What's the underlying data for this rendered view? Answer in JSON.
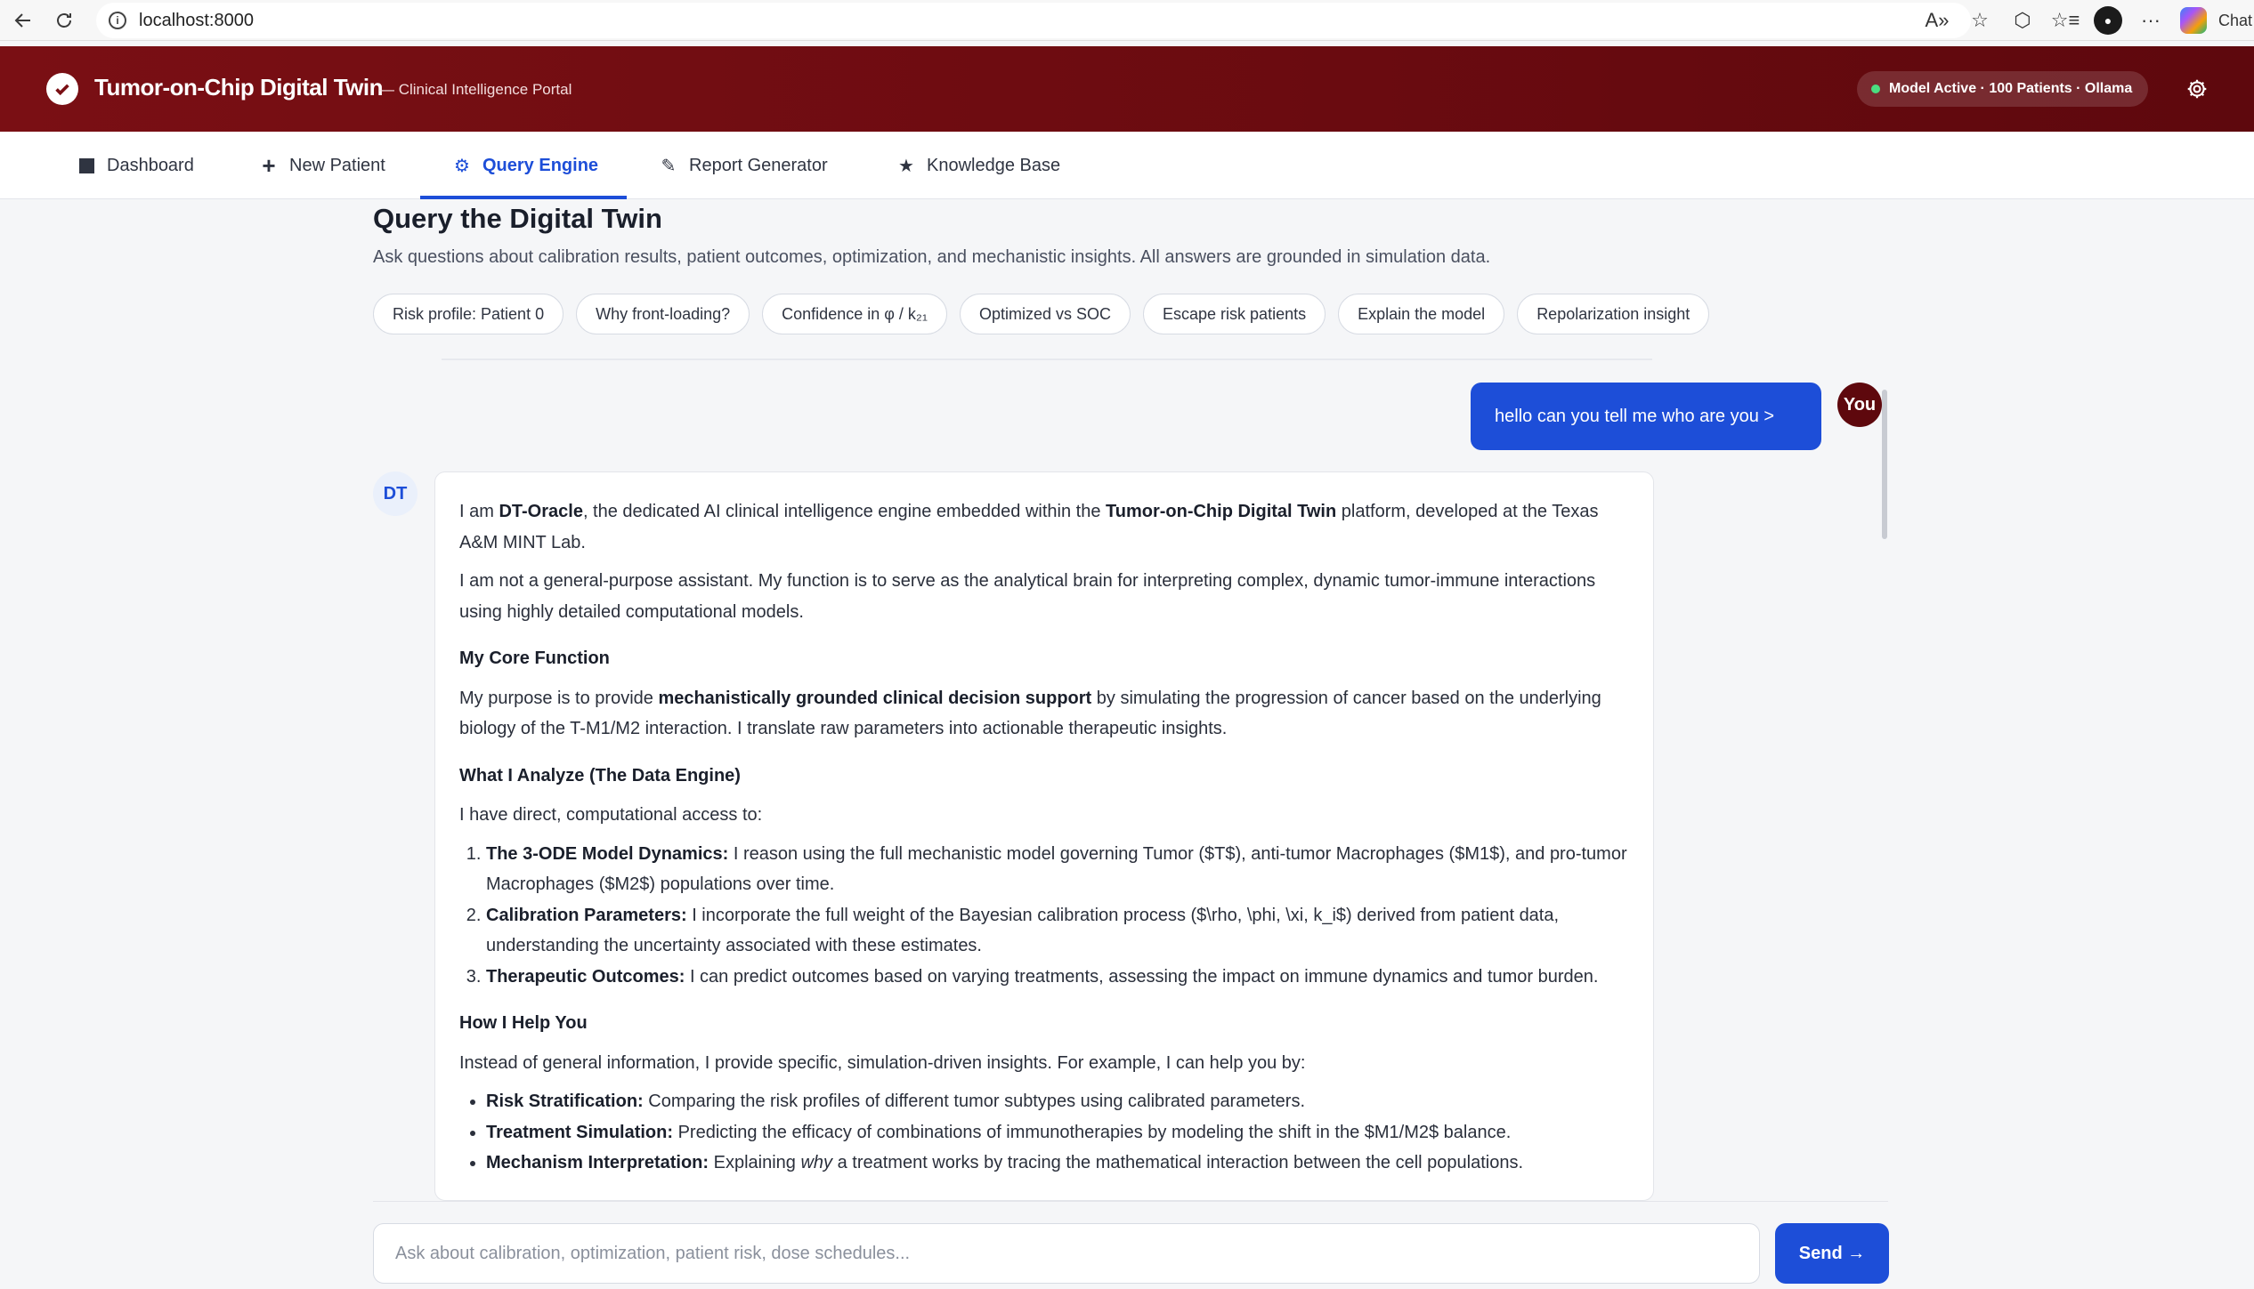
{
  "browser": {
    "url": "localhost:8000",
    "chat_label": "Chat"
  },
  "header": {
    "title": "Tumor-on-Chip Digital Twin",
    "subtitle": "— Clinical Intelligence Portal",
    "status": "Model Active · 100 Patients · Ollama",
    "accent": "#6a0b10"
  },
  "tabs": [
    {
      "label": "Dashboard",
      "icon": "square-icon"
    },
    {
      "label": "New Patient",
      "icon": "plus-icon"
    },
    {
      "label": "Query Engine",
      "icon": "gear-icon",
      "active": true
    },
    {
      "label": "Report Generator",
      "icon": "pen-icon"
    },
    {
      "label": "Knowledge Base",
      "icon": "star-icon"
    }
  ],
  "main": {
    "title": "Query the Digital Twin",
    "subtitle": "Ask questions about calibration results, patient outcomes, optimization, and mechanistic insights. All answers are grounded in simulation data.",
    "chips": [
      "Risk profile: Patient 0",
      "Why front-loading?",
      "Confidence in φ / k₂₁",
      "Optimized vs SOC",
      "Escape risk patients",
      "Explain the model",
      "Repolarization insight"
    ]
  },
  "chat": {
    "user_avatar": "You",
    "user_message": "hello can you tell me who are you >",
    "bot_avatar": "DT",
    "bot": {
      "p1_a": "I am ",
      "p1_b": "DT-Oracle",
      "p1_c": ", the dedicated AI clinical intelligence engine embedded within the ",
      "p1_d": "Tumor-on-Chip Digital Twin",
      "p1_e": " platform, developed at the Texas A&M MINT Lab.",
      "p2": "I am not a general-purpose assistant. My function is to serve as the analytical brain for interpreting complex, dynamic tumor-immune interactions using highly detailed computational models.",
      "h1": "My Core Function",
      "p3_a": "My purpose is to provide ",
      "p3_b": "mechanistically grounded clinical decision support",
      "p3_c": " by simulating the progression of cancer based on the underlying biology of the T-M1/M2 interaction. I translate raw parameters into actionable therapeutic insights.",
      "h2": "What I Analyze (The Data Engine)",
      "p4": "I have direct, computational access to:",
      "ol": [
        {
          "b": "The 3-ODE Model Dynamics:",
          "t": " I reason using the full mechanistic model governing Tumor ($T$), anti-tumor Macrophages ($M1$), and pro-tumor Macrophages ($M2$) populations over time."
        },
        {
          "b": "Calibration Parameters:",
          "t": " I incorporate the full weight of the Bayesian calibration process ($\\rho, \\phi, \\xi, k_i$) derived from patient data, understanding the uncertainty associated with these estimates."
        },
        {
          "b": "Therapeutic Outcomes:",
          "t": " I can predict outcomes based on varying treatments, assessing the impact on immune dynamics and tumor burden."
        }
      ],
      "h3": "How I Help You",
      "p5": "Instead of general information, I provide specific, simulation-driven insights. For example, I can help you by:",
      "ul": [
        {
          "b": "Risk Stratification:",
          "t": " Comparing the risk profiles of different tumor subtypes using calibrated parameters."
        },
        {
          "b": "Treatment Simulation:",
          "t": " Predicting the efficacy of combinations of immunotherapies by modeling the shift in the $M1/M2$ balance."
        },
        {
          "b": "Mechanism Interpretation:",
          "t1": " Explaining ",
          "em": "why",
          "t2": " a treatment works by tracing the mathematical interaction between the cell populations."
        }
      ]
    }
  },
  "composer": {
    "placeholder": "Ask about calibration, optimization, patient risk, dose schedules...",
    "send_label": "Send →"
  }
}
